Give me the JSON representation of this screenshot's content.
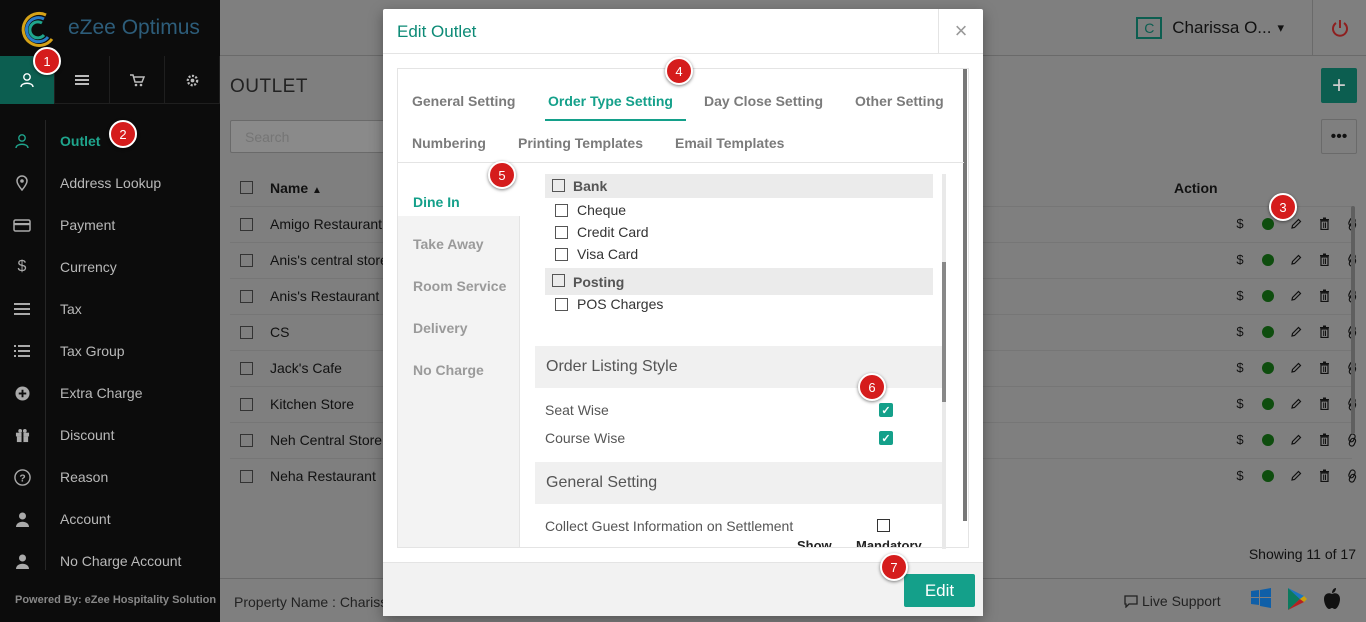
{
  "app": {
    "brand": "eZee Optimus",
    "powered_by": "Powered By: eZee Hospitality Solution",
    "accent": "#14a08a"
  },
  "header": {
    "user_initial": "C",
    "user_name": "Charissa O...",
    "dropdown_glyph": "▾",
    "power_icon": "power-icon"
  },
  "sidebar": {
    "top_icons": [
      "user-icon",
      "list-icon",
      "cart-icon",
      "gear-icon"
    ],
    "items": [
      {
        "label": "Outlet",
        "icon": "user-icon",
        "active": true
      },
      {
        "label": "Address Lookup",
        "icon": "map-pin-icon"
      },
      {
        "label": "Payment",
        "icon": "card-icon"
      },
      {
        "label": "Currency",
        "icon": "dollar-icon"
      },
      {
        "label": "Tax",
        "icon": "lines-icon"
      },
      {
        "label": "Tax Group",
        "icon": "list-icon"
      },
      {
        "label": "Extra Charge",
        "icon": "plus-circle-icon"
      },
      {
        "label": "Discount",
        "icon": "gift-icon"
      },
      {
        "label": "Reason",
        "icon": "question-icon"
      },
      {
        "label": "Account",
        "icon": "person-icon"
      },
      {
        "label": "No Charge Account",
        "icon": "person-icon"
      }
    ]
  },
  "main": {
    "title": "OUTLET",
    "add_glyph": "+",
    "more_glyph": "•••",
    "search_placeholder": "Search",
    "col_name": "Name",
    "sort_glyph": "▲",
    "col_action": "Action",
    "rows": [
      "Amigo Restaurant",
      "Anis's central store",
      "Anis's Restaurant",
      "CS",
      "Jack's Cafe",
      "Kitchen Store",
      "Neh Central Store",
      "Neha Restaurant"
    ],
    "row_action_currency": "$",
    "showing": "Showing 11 of 17"
  },
  "footer": {
    "property_label": "Property Name : Chariss",
    "live_support": "Live Support"
  },
  "modal": {
    "title": "Edit Outlet",
    "close_glyph": "×",
    "tabs_row1": [
      "General Setting",
      "Order Type Setting",
      "Day Close Setting",
      "Other Setting"
    ],
    "tabs_row2": [
      "Numbering",
      "Printing Templates",
      "Email Templates"
    ],
    "left_nav": [
      "Dine In",
      "Take Away",
      "Room Service",
      "Delivery",
      "No Charge"
    ],
    "groups": [
      {
        "label": "Bank",
        "options": [
          "Cheque",
          "Credit Card",
          "Visa Card"
        ]
      },
      {
        "label": "Posting",
        "options": [
          "POS Charges"
        ]
      }
    ],
    "listing_style_title": "Order Listing Style",
    "listing_options": [
      {
        "label": "Seat Wise",
        "checked": true
      },
      {
        "label": "Course Wise",
        "checked": true
      }
    ],
    "general_title": "General Setting",
    "general_options": [
      {
        "label": "Collect Guest Information on Settlement",
        "checked": false
      }
    ],
    "col_show": "Show",
    "col_mandatory": "Mandatory",
    "edit_label": "Edit"
  },
  "markers": [
    "1",
    "2",
    "3",
    "4",
    "5",
    "6",
    "7"
  ]
}
